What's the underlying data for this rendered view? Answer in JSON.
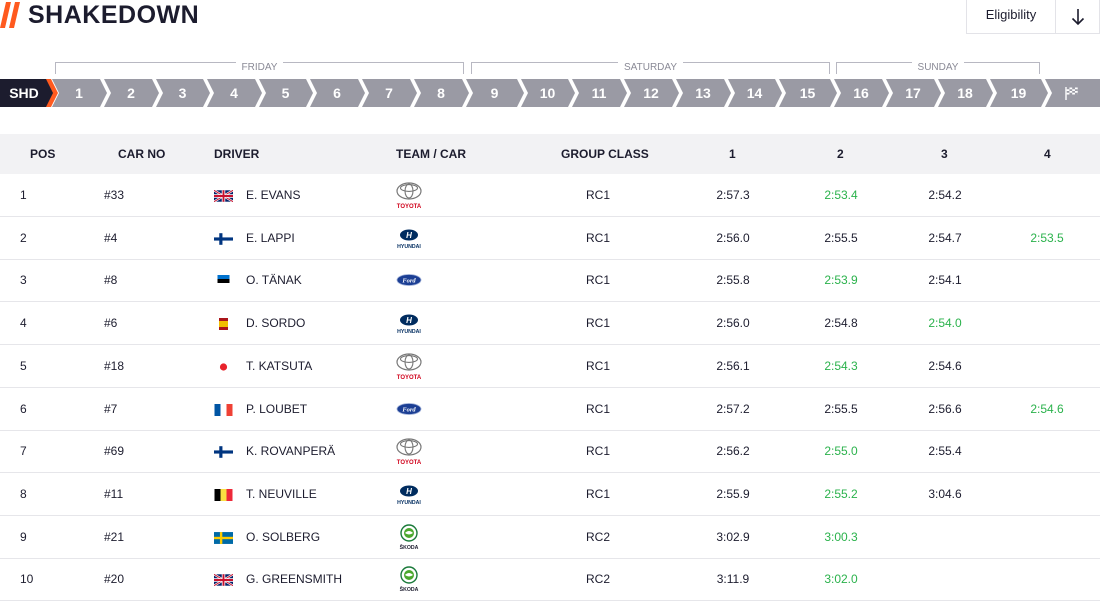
{
  "header": {
    "title": "SHAKEDOWN",
    "eligibility_label": "Eligibility",
    "accent_color": "#ff5a1f",
    "dark_color": "#1c1c2e"
  },
  "days": [
    "FRIDAY",
    "SATURDAY",
    "SUNDAY"
  ],
  "stages": [
    "SHD",
    "1",
    "2",
    "3",
    "4",
    "5",
    "6",
    "7",
    "8",
    "9",
    "10",
    "11",
    "12",
    "13",
    "14",
    "15",
    "16",
    "17",
    "18",
    "19"
  ],
  "finish_icon": "flag-icon",
  "columns": [
    "POS",
    "CAR NO",
    "DRIVER",
    "TEAM / CAR",
    "GROUP CLASS",
    "1",
    "2",
    "3",
    "4"
  ],
  "fastest_color": "#2bb24c",
  "rows": [
    {
      "pos": "1",
      "car": "#33",
      "driver": "E. EVANS",
      "flag": "gb",
      "team": "TOYOTA",
      "cls": "RC1",
      "t1": "2:57.3",
      "t2": "2:53.4",
      "t3": "2:54.2",
      "t4": "",
      "best": 2
    },
    {
      "pos": "2",
      "car": "#4",
      "driver": "E. LAPPI",
      "flag": "fi",
      "team": "HYUNDAI",
      "cls": "RC1",
      "t1": "2:56.0",
      "t2": "2:55.5",
      "t3": "2:54.7",
      "t4": "2:53.5",
      "best": 4
    },
    {
      "pos": "3",
      "car": "#8",
      "driver": "O. TÄNAK",
      "flag": "ee",
      "team": "FORD",
      "cls": "RC1",
      "t1": "2:55.8",
      "t2": "2:53.9",
      "t3": "2:54.1",
      "t4": "",
      "best": 2
    },
    {
      "pos": "4",
      "car": "#6",
      "driver": "D. SORDO",
      "flag": "es",
      "team": "HYUNDAI",
      "cls": "RC1",
      "t1": "2:56.0",
      "t2": "2:54.8",
      "t3": "2:54.0",
      "t4": "",
      "best": 3
    },
    {
      "pos": "5",
      "car": "#18",
      "driver": "T. KATSUTA",
      "flag": "jp",
      "team": "TOYOTA",
      "cls": "RC1",
      "t1": "2:56.1",
      "t2": "2:54.3",
      "t3": "2:54.6",
      "t4": "",
      "best": 2
    },
    {
      "pos": "6",
      "car": "#7",
      "driver": "P. LOUBET",
      "flag": "fr",
      "team": "FORD",
      "cls": "RC1",
      "t1": "2:57.2",
      "t2": "2:55.5",
      "t3": "2:56.6",
      "t4": "2:54.6",
      "best": 4
    },
    {
      "pos": "7",
      "car": "#69",
      "driver": "K. ROVANPERÄ",
      "flag": "fi",
      "team": "TOYOTA",
      "cls": "RC1",
      "t1": "2:56.2",
      "t2": "2:55.0",
      "t3": "2:55.4",
      "t4": "",
      "best": 2
    },
    {
      "pos": "8",
      "car": "#11",
      "driver": "T. NEUVILLE",
      "flag": "be",
      "team": "HYUNDAI",
      "cls": "RC1",
      "t1": "2:55.9",
      "t2": "2:55.2",
      "t3": "3:04.6",
      "t4": "",
      "best": 2
    },
    {
      "pos": "9",
      "car": "#21",
      "driver": "O. SOLBERG",
      "flag": "se",
      "team": "ŠKODA",
      "cls": "RC2",
      "t1": "3:02.9",
      "t2": "3:00.3",
      "t3": "",
      "t4": "",
      "best": 2
    },
    {
      "pos": "10",
      "car": "#20",
      "driver": "G. GREENSMITH",
      "flag": "gb",
      "team": "ŠKODA",
      "cls": "RC2",
      "t1": "3:11.9",
      "t2": "3:02.0",
      "t3": "",
      "t4": "",
      "best": 2
    }
  ]
}
